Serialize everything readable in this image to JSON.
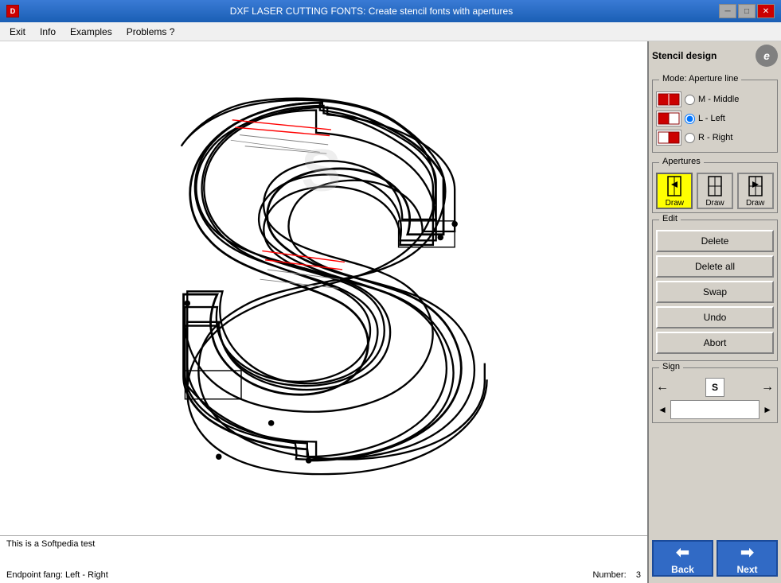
{
  "titleBar": {
    "title": "DXF LASER CUTTING FONTS: Create stencil fonts with apertures",
    "appIconText": "D"
  },
  "menu": {
    "items": [
      "Exit",
      "Info",
      "Examples",
      "Problems ?"
    ]
  },
  "rightPanel": {
    "title": "Stencil design",
    "iconLabel": "e",
    "modeLabel": "Mode: Aperture line",
    "radioOptions": [
      {
        "id": "m-middle",
        "label": "M - Middle",
        "checked": false
      },
      {
        "id": "l-left",
        "label": "L - Left",
        "checked": true
      },
      {
        "id": "r-right",
        "label": "R - Right",
        "checked": false
      }
    ],
    "aperturesLabel": "Apertures",
    "apertureButtons": [
      {
        "label": "Draw",
        "active": true
      },
      {
        "label": "Draw",
        "active": false
      },
      {
        "label": "Draw",
        "active": false
      }
    ],
    "editLabel": "Edit",
    "editButtons": [
      "Delete",
      "Delete all",
      "Swap",
      "Undo",
      "Abort"
    ],
    "signLabel": "Sign",
    "signLetter": "S",
    "navButtons": [
      {
        "label": "Back",
        "direction": "back"
      },
      {
        "label": "Next",
        "direction": "next"
      }
    ]
  },
  "statusBar": {
    "line1": "This is a Softpedia test",
    "line2left": "Endpoint fang: Left - Right",
    "line2right": "Number:",
    "number": "3"
  }
}
